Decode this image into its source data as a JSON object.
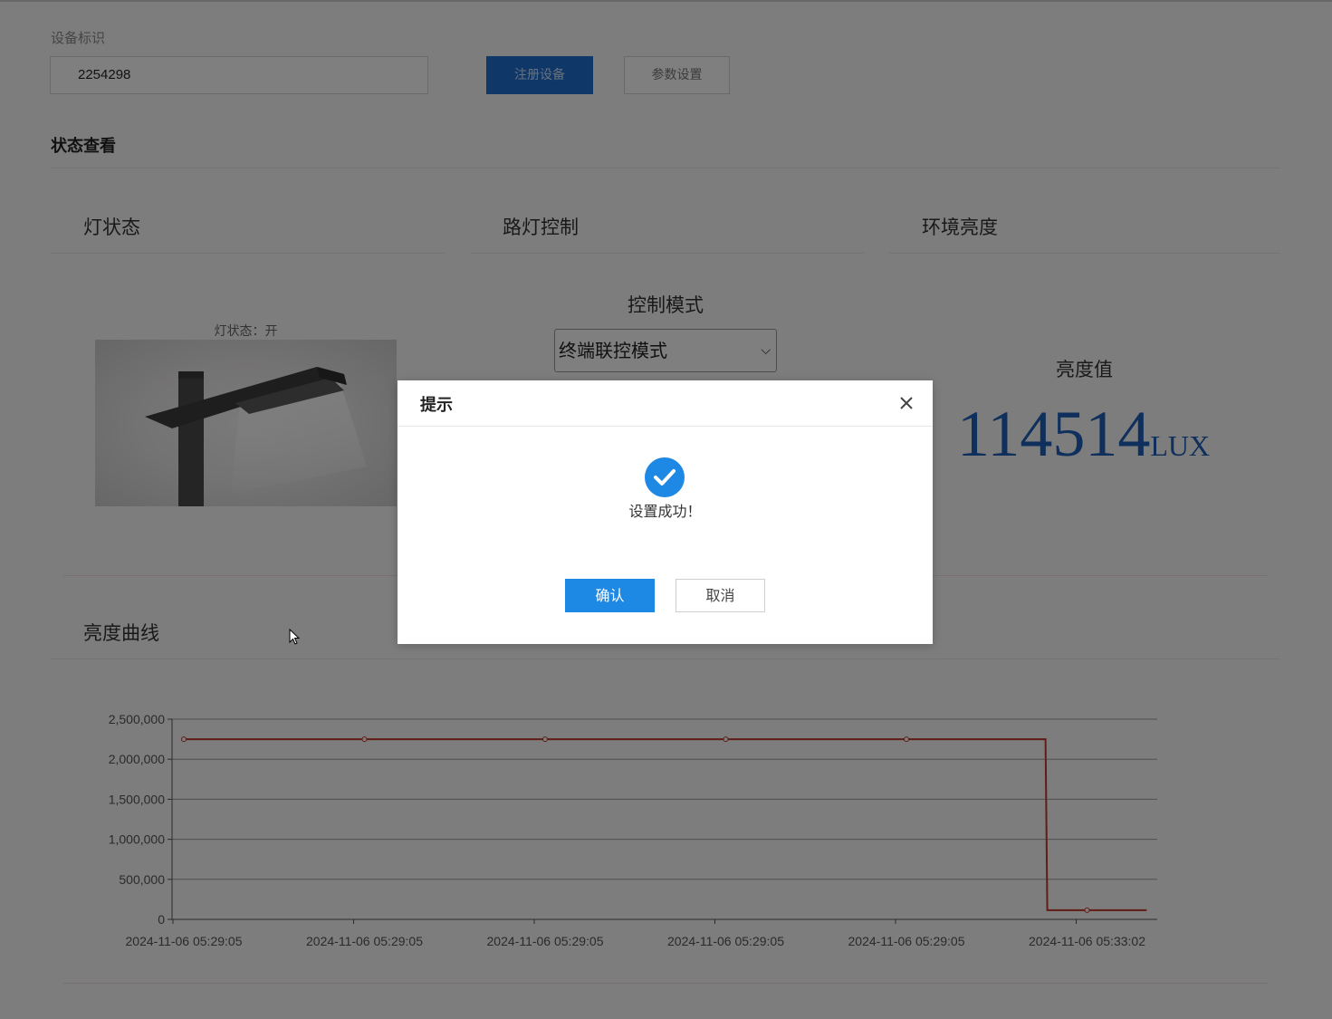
{
  "device": {
    "label": "设备标识",
    "id_value": "2254298",
    "register_button": "注册设备",
    "settings_button": "参数设置"
  },
  "status_section": {
    "title": "状态查看"
  },
  "lamp_panel": {
    "title": "灯状态",
    "caption": "灯状态：开",
    "image_icon": "street-lamp-image"
  },
  "control_panel": {
    "title": "路灯控制",
    "mode_label": "控制模式",
    "mode_selected": "终端联控模式"
  },
  "brightness_panel": {
    "title": "环境亮度",
    "value_label": "亮度值",
    "value": "114514",
    "unit": "LUX"
  },
  "curve_section": {
    "title": "亮度曲线"
  },
  "colors": {
    "primary_blue": "#1e6fd0",
    "brightness_value": "#1f5fb8",
    "series_line": "#c0392b",
    "success_icon": "#1e88e5"
  },
  "chart_data": {
    "type": "line",
    "title": "",
    "xlabel": "",
    "ylabel": "",
    "ylim": [
      0,
      2500000
    ],
    "yticks": [
      "0",
      "500,000",
      "1,000,000",
      "1,500,000",
      "2,000,000",
      "2,500,000"
    ],
    "yticks_values": [
      0,
      500000,
      1000000,
      1500000,
      2000000,
      2500000
    ],
    "categories": [
      "2024-11-06 05:29:05",
      "2024-11-06 05:29:05",
      "2024-11-06 05:29:05",
      "2024-11-06 05:29:05",
      "2024-11-06 05:29:05",
      "2024-11-06 05:33:02"
    ],
    "series": [
      {
        "values": [
          2250000,
          2250000,
          2250000,
          2250000,
          2250000,
          2250000,
          2250000,
          114514,
          114514,
          114514
        ],
        "x_index": [
          0,
          1,
          2,
          3,
          4,
          4.67,
          4.77,
          4.78,
          5.0,
          5.33
        ]
      }
    ],
    "grid": true
  },
  "dialog": {
    "title": "提示",
    "close_icon": "close-icon",
    "status_icon": "check-circle-icon",
    "message": "设置成功！",
    "confirm_label": "确认",
    "cancel_label": "取消"
  }
}
